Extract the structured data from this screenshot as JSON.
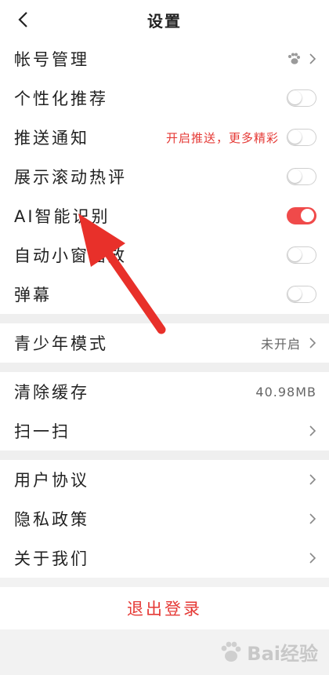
{
  "header": {
    "title": "设置"
  },
  "group1": [
    {
      "label": "帐号管理",
      "control": "chevron",
      "icon": "paw-icon"
    },
    {
      "label": "个性化推荐",
      "control": "toggle",
      "on": false
    },
    {
      "label": "推送通知",
      "control": "toggle",
      "on": false,
      "hint": "开启推送，更多精彩"
    },
    {
      "label": "展示滚动热评",
      "control": "toggle",
      "on": false
    },
    {
      "label": "AI智能识别",
      "control": "toggle",
      "on": true
    },
    {
      "label": "自动小窗播放",
      "control": "toggle",
      "on": false
    },
    {
      "label": "弹幕",
      "control": "toggle",
      "on": false
    }
  ],
  "group2": [
    {
      "label": "青少年模式",
      "value": "未开启"
    }
  ],
  "group3": [
    {
      "label": "清除缓存",
      "value": "40.98MB"
    },
    {
      "label": "扫一扫"
    }
  ],
  "group4": [
    {
      "label": "用户协议"
    },
    {
      "label": "隐私政策"
    },
    {
      "label": "关于我们"
    }
  ],
  "logout": {
    "label": "退出登录"
  },
  "watermark": {
    "text": "Bai经验"
  },
  "colors": {
    "accent": "#e53935",
    "toggle_on": "#f04a4a",
    "annotation_arrow": "#e8302a"
  }
}
